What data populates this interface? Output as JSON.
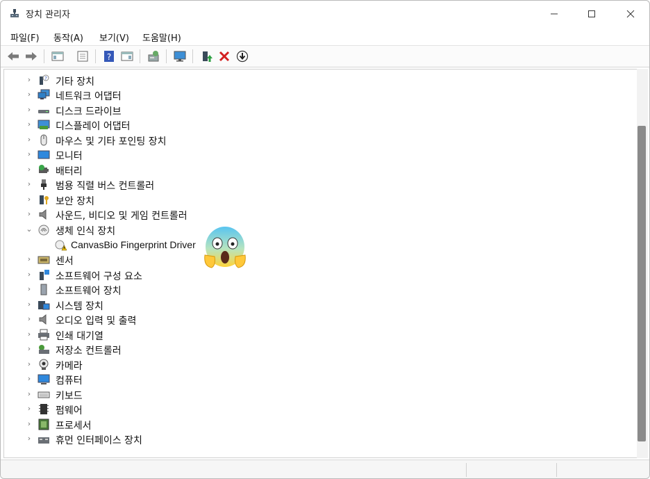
{
  "window": {
    "title": "장치 관리자"
  },
  "menu": [
    {
      "label": "파일(F)"
    },
    {
      "label": "동작(A)"
    },
    {
      "label": "보기(V)"
    },
    {
      "label": "도움말(H)"
    }
  ],
  "toolbar": {
    "buttons": [
      {
        "name": "back-arrow-icon"
      },
      {
        "name": "forward-arrow-icon"
      },
      {
        "name": "tree-view-icon"
      },
      {
        "name": "properties-icon"
      },
      {
        "name": "help-icon"
      },
      {
        "name": "action-pane-icon"
      },
      {
        "name": "scan-hardware-icon"
      },
      {
        "name": "monitor-icon"
      },
      {
        "name": "update-driver-icon"
      },
      {
        "name": "uninstall-x-icon"
      },
      {
        "name": "download-circle-icon"
      }
    ]
  },
  "tree": [
    {
      "label": "기타 장치",
      "icon": "unknown-device-icon",
      "expanded": false
    },
    {
      "label": "네트워크 어댑터",
      "icon": "network-adapter-icon",
      "expanded": false
    },
    {
      "label": "디스크 드라이브",
      "icon": "disk-drive-icon",
      "expanded": false
    },
    {
      "label": "디스플레이 어댑터",
      "icon": "display-adapter-icon",
      "expanded": false
    },
    {
      "label": "마우스 및 기타 포인팅 장치",
      "icon": "mouse-icon",
      "expanded": false
    },
    {
      "label": "모니터",
      "icon": "monitor-icon",
      "expanded": false
    },
    {
      "label": "배터리",
      "icon": "battery-icon",
      "expanded": false
    },
    {
      "label": "범용 직렬 버스 컨트롤러",
      "icon": "usb-icon",
      "expanded": false
    },
    {
      "label": "보안 장치",
      "icon": "security-device-icon",
      "expanded": false
    },
    {
      "label": "사운드, 비디오 및 게임 컨트롤러",
      "icon": "speaker-icon",
      "expanded": false
    },
    {
      "label": "생체 인식 장치",
      "icon": "fingerprint-icon",
      "expanded": true
    },
    {
      "label": "CanvasBio Fingerprint Driver",
      "icon": "warning-driver-icon",
      "child": true
    },
    {
      "label": "센서",
      "icon": "sensor-icon",
      "expanded": false
    },
    {
      "label": "소프트웨어 구성 요소",
      "icon": "software-component-icon",
      "expanded": false
    },
    {
      "label": "소프트웨어 장치",
      "icon": "software-device-icon",
      "expanded": false
    },
    {
      "label": "시스템 장치",
      "icon": "system-device-icon",
      "expanded": false
    },
    {
      "label": "오디오 입력 및 출력",
      "icon": "audio-io-icon",
      "expanded": false
    },
    {
      "label": "인쇄 대기열",
      "icon": "printer-icon",
      "expanded": false
    },
    {
      "label": "저장소 컨트롤러",
      "icon": "storage-controller-icon",
      "expanded": false
    },
    {
      "label": "카메라",
      "icon": "camera-icon",
      "expanded": false
    },
    {
      "label": "컴퓨터",
      "icon": "computer-icon",
      "expanded": false
    },
    {
      "label": "키보드",
      "icon": "keyboard-icon",
      "expanded": false
    },
    {
      "label": "펌웨어",
      "icon": "firmware-icon",
      "expanded": false
    },
    {
      "label": "프로세서",
      "icon": "processor-icon",
      "expanded": false
    },
    {
      "label": "휴먼 인터페이스 장치",
      "icon": "hid-icon",
      "expanded": false
    }
  ],
  "overlay": {
    "icon": "screaming-face-emoji-icon"
  },
  "colors": {
    "accent": "#1a73c9",
    "warning": "#f2c200",
    "error": "#d32020",
    "scroll_thumb": "#8a8a8a"
  }
}
